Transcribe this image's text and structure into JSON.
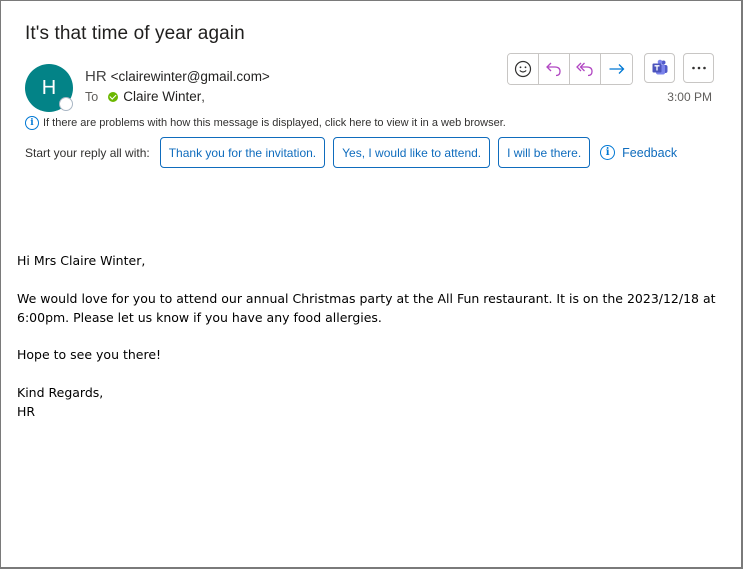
{
  "message": {
    "subject": "It's that time of year again",
    "sender": {
      "initial": "H",
      "name": "HR",
      "email": "<clairewinter@gmail.com>",
      "avatar_color": "#038387"
    },
    "to_label": "To",
    "recipient": "Claire Winter",
    "time": "3:00 PM"
  },
  "toolbar": {
    "buttons": [
      {
        "icon": "emoji-icon",
        "label": "React"
      },
      {
        "icon": "reply-icon",
        "label": "Reply"
      },
      {
        "icon": "reply-all-icon",
        "label": "Reply All"
      },
      {
        "icon": "forward-icon",
        "label": "Forward"
      }
    ],
    "teams_icon": "teams-icon",
    "more_icon": "more-icon",
    "reply_color": "#b146c2",
    "forward_color": "#0078d4"
  },
  "infobar": {
    "text": "If there are problems with how this message is displayed, click here to view it in a web browser."
  },
  "suggested_replies": {
    "label": "Start your reply all with:",
    "items": [
      "Thank you for the invitation.",
      "Yes, I would like to attend.",
      "I will be there."
    ],
    "feedback": "Feedback",
    "accent": "#0f6cbd"
  },
  "body": {
    "greeting": "Hi Mrs Claire Winter,",
    "paragraph": "We would love for you to attend our annual Christmas party at the All Fun restaurant. It is on the 2023/12/18 at 6:00pm. Please let us know if you have any food allergies.",
    "closing_line": "Hope to see you there!",
    "signoff": "Kind Regards,",
    "signature": "HR"
  }
}
